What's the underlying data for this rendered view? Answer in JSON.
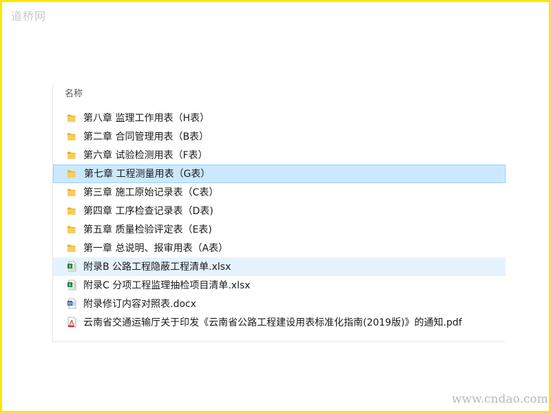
{
  "watermarks": {
    "top": "道桥网",
    "bottom": "www.cndao.com"
  },
  "explorer": {
    "column_header": "名称",
    "items": [
      {
        "label": "第八章  监理工作用表（H表）",
        "type": "folder",
        "state": "normal",
        "icon": "folder-icon"
      },
      {
        "label": "第二章  合同管理用表（B表）",
        "type": "folder",
        "state": "normal",
        "icon": "folder-icon"
      },
      {
        "label": "第六章  试验检测用表（F表）",
        "type": "folder",
        "state": "normal",
        "icon": "folder-icon"
      },
      {
        "label": "第七章  工程测量用表（G表）",
        "type": "folder",
        "state": "selected",
        "icon": "folder-icon"
      },
      {
        "label": "第三章  施工原始记录表（C表）",
        "type": "folder",
        "state": "normal",
        "icon": "folder-icon"
      },
      {
        "label": "第四章  工序检查记录表（D表)",
        "type": "folder",
        "state": "normal",
        "icon": "folder-icon"
      },
      {
        "label": "第五章  质量检验评定表（E表)",
        "type": "folder",
        "state": "normal",
        "icon": "folder-icon"
      },
      {
        "label": "第一章  总说明、报审用表（A表）",
        "type": "folder",
        "state": "normal",
        "icon": "folder-icon"
      },
      {
        "label": "附录B 公路工程隐蔽工程清单.xlsx",
        "type": "xlsx",
        "state": "hover",
        "icon": "excel-file-icon"
      },
      {
        "label": "附录C 分项工程监理抽检项目清单.xlsx",
        "type": "xlsx",
        "state": "normal",
        "icon": "excel-file-icon"
      },
      {
        "label": "附录修订内容对照表.docx",
        "type": "docx",
        "state": "normal",
        "icon": "word-file-icon"
      },
      {
        "label": "云南省交通运输厅关于印发《云南省公路工程建设用表标准化指南(2019版)》的通知.pdf",
        "type": "pdf",
        "state": "normal",
        "icon": "pdf-file-icon"
      }
    ]
  },
  "colors": {
    "selected_bg": "#cce8ff",
    "hover_bg": "#e5f3ff",
    "border_frame": "#ffe600",
    "folder": "#f6c343"
  }
}
